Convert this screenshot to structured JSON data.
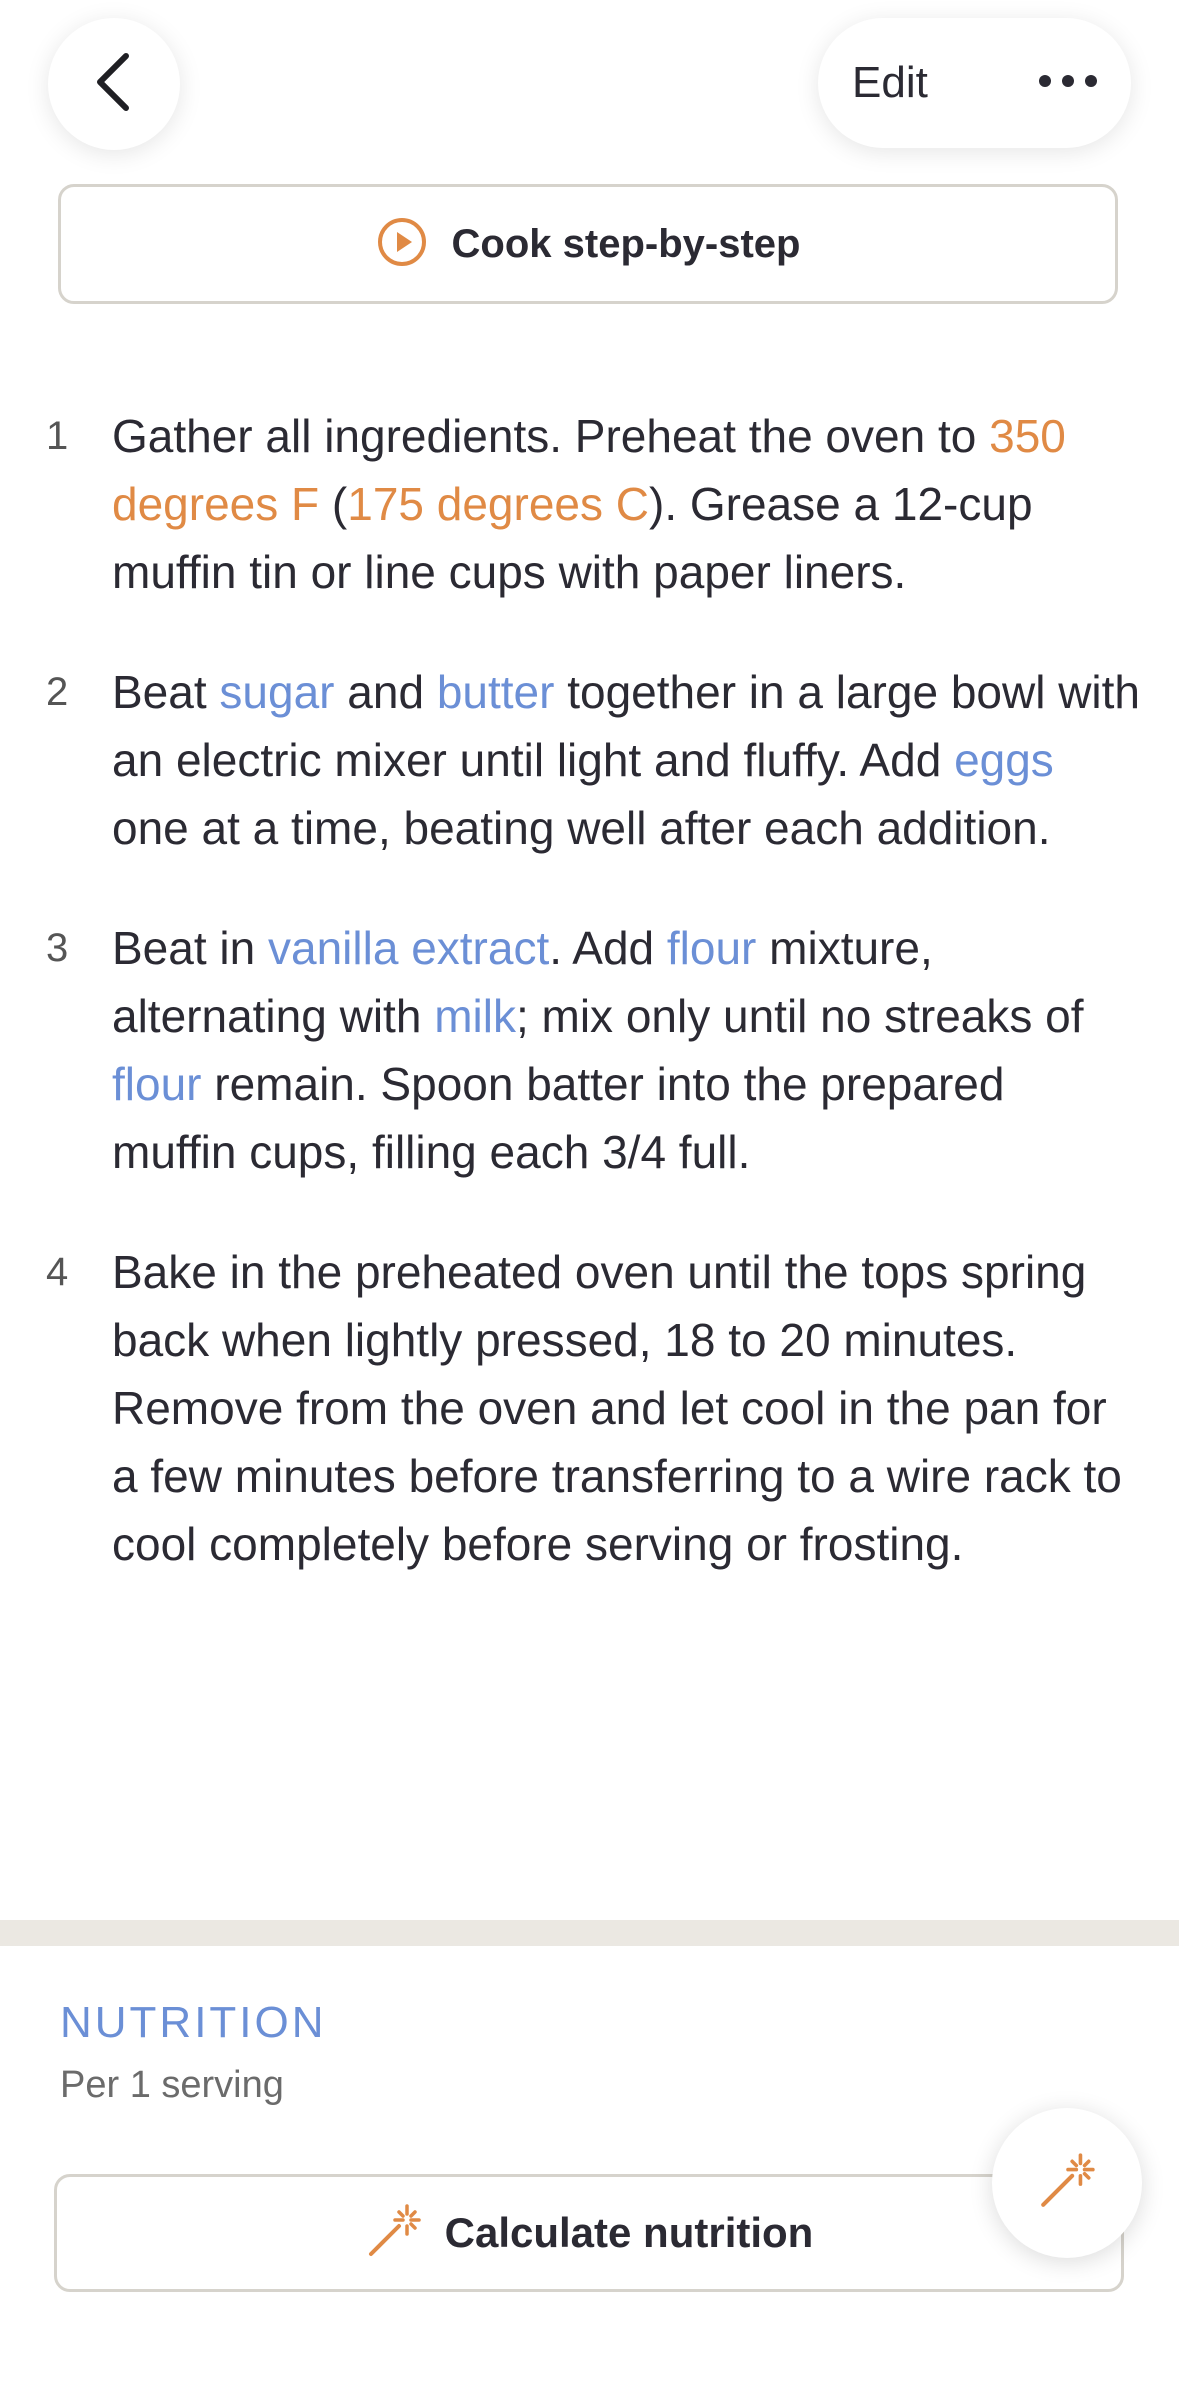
{
  "header": {
    "back_icon": "chevron-left-icon",
    "edit_label": "Edit",
    "more_icon": "ellipsis-icon"
  },
  "cook_button": {
    "icon": "play-circle-icon",
    "label": "Cook step-by-step"
  },
  "steps": [
    {
      "number": "1",
      "segments": [
        {
          "text": "Gather all ingredients. Preheat the oven to ",
          "type": "plain"
        },
        {
          "text": "350 degrees F",
          "type": "temp"
        },
        {
          "text": " (",
          "type": "plain"
        },
        {
          "text": "175 degrees C",
          "type": "temp"
        },
        {
          "text": "). Grease a 12-cup muffin tin or line cups with paper liners.",
          "type": "plain"
        }
      ]
    },
    {
      "number": "2",
      "segments": [
        {
          "text": "Beat ",
          "type": "plain"
        },
        {
          "text": "sugar",
          "type": "ingredient"
        },
        {
          "text": " and ",
          "type": "plain"
        },
        {
          "text": "butter",
          "type": "ingredient"
        },
        {
          "text": " together in a large bowl with an electric mixer until light and fluffy. Add ",
          "type": "plain"
        },
        {
          "text": "eggs",
          "type": "ingredient"
        },
        {
          "text": " one at a time, beating well after each addition.",
          "type": "plain"
        }
      ]
    },
    {
      "number": "3",
      "segments": [
        {
          "text": "Beat in ",
          "type": "plain"
        },
        {
          "text": "vanilla extract",
          "type": "ingredient"
        },
        {
          "text": ". Add ",
          "type": "plain"
        },
        {
          "text": "flour",
          "type": "ingredient"
        },
        {
          "text": " mixture, alternating with ",
          "type": "plain"
        },
        {
          "text": "milk",
          "type": "ingredient"
        },
        {
          "text": "; mix only until no streaks of ",
          "type": "plain"
        },
        {
          "text": "flour",
          "type": "ingredient"
        },
        {
          "text": " remain. Spoon batter into the prepared muffin cups, filling each 3/4 full.",
          "type": "plain"
        }
      ]
    },
    {
      "number": "4",
      "segments": [
        {
          "text": "Bake in the preheated oven until the tops spring back when lightly pressed, 18 to 20 minutes. Remove from the oven and let cool in the pan for a few minutes before transferring to a wire rack to cool completely before serving or frosting.",
          "type": "plain"
        }
      ]
    }
  ],
  "nutrition": {
    "title": "NUTRITION",
    "subtitle": "Per 1 serving",
    "button_icon": "magic-wand-icon",
    "button_label": "Calculate nutrition"
  },
  "fab": {
    "icon": "magic-wand-icon"
  },
  "colors": {
    "accent_orange": "#e08a45",
    "ingredient_blue": "#6b8fd6",
    "text": "#2b2a33",
    "divider": "#ebe8e2"
  }
}
